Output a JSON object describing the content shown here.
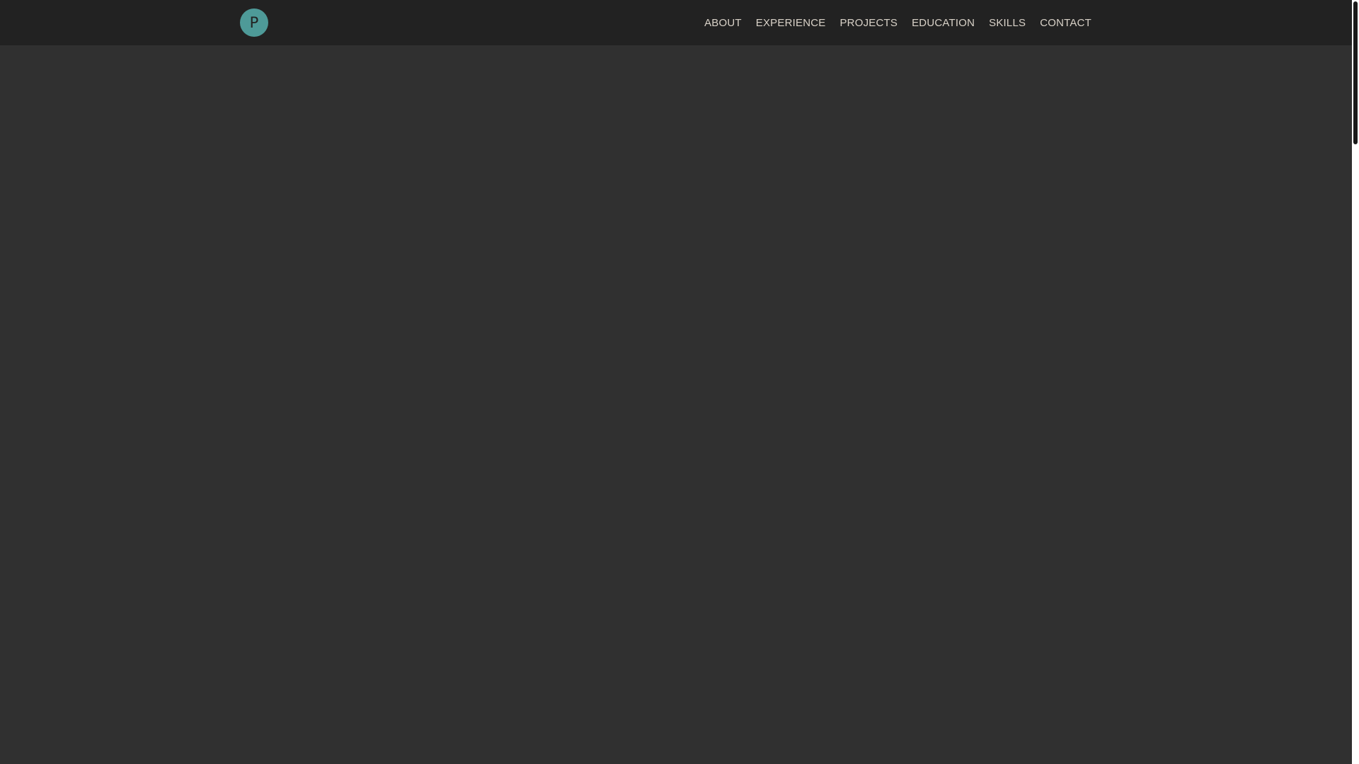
{
  "header": {
    "logo_letter": "P",
    "logo_color": "#4e9a98",
    "nav_items": [
      {
        "label": "ABOUT"
      },
      {
        "label": "EXPERIENCE"
      },
      {
        "label": "PROJECTS"
      },
      {
        "label": "EDUCATION"
      },
      {
        "label": "SKILLS"
      },
      {
        "label": "CONTACT"
      }
    ]
  },
  "colors": {
    "navbar_background": "#222222",
    "page_background": "#303030",
    "nav_text": "#d9d2c8",
    "scrollbar_thumb": "#1a1a1a"
  }
}
